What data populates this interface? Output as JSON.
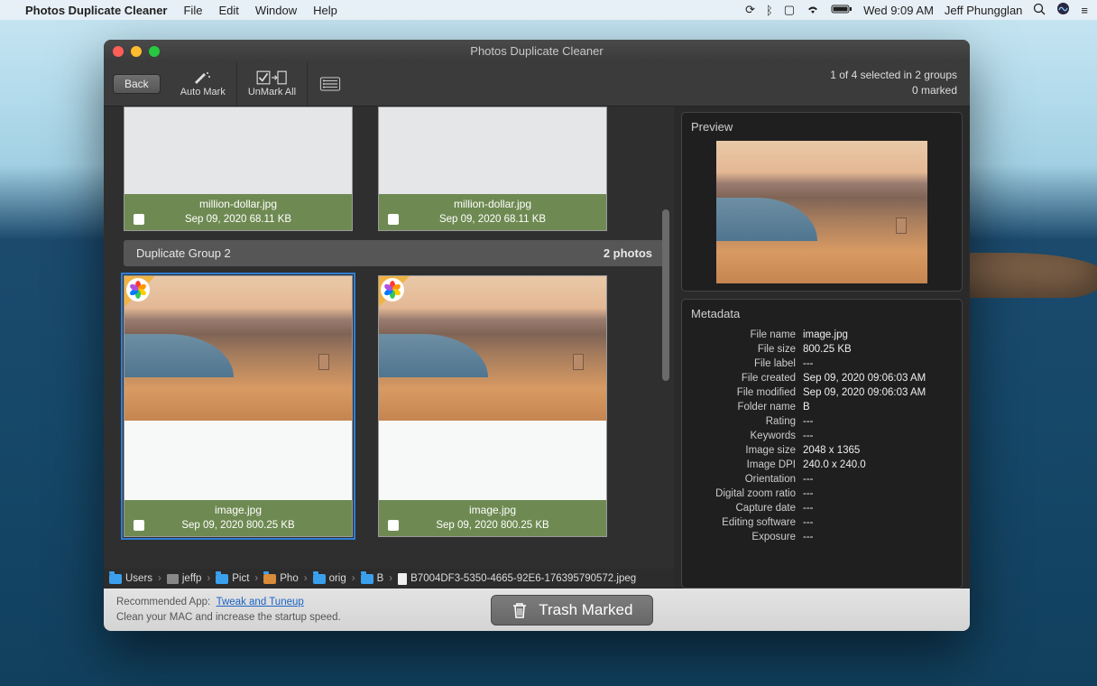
{
  "menubar": {
    "app_name": "Photos Duplicate Cleaner",
    "menus": [
      "File",
      "Edit",
      "Window",
      "Help"
    ],
    "clock": "Wed 9:09 AM",
    "user": "Jeff Phungglan"
  },
  "window": {
    "title": "Photos Duplicate Cleaner",
    "back": "Back",
    "tools": {
      "auto_mark": "Auto Mark",
      "unmark_all": "UnMark All"
    },
    "status_line1": "1 of 4 selected in 2 groups",
    "status_line2": "0 marked"
  },
  "groups": {
    "g1": {
      "cards": [
        {
          "name": "million-dollar.jpg",
          "sub": "Sep 09, 2020  68.11 KB"
        },
        {
          "name": "million-dollar.jpg",
          "sub": "Sep 09, 2020  68.11 KB"
        }
      ]
    },
    "g2": {
      "title": "Duplicate Group 2",
      "count": "2 photos",
      "cards": [
        {
          "name": "image.jpg",
          "sub": "Sep 09, 2020  800.25 KB"
        },
        {
          "name": "image.jpg",
          "sub": "Sep 09, 2020  800.25 KB"
        }
      ]
    }
  },
  "preview": {
    "title": "Preview"
  },
  "metadata": {
    "title": "Metadata",
    "rows": [
      {
        "k": "File name",
        "v": "image.jpg"
      },
      {
        "k": "File size",
        "v": "800.25 KB"
      },
      {
        "k": "File label",
        "v": "---"
      },
      {
        "k": "File created",
        "v": "Sep 09, 2020 09:06:03 AM"
      },
      {
        "k": "File modified",
        "v": "Sep 09, 2020 09:06:03 AM"
      },
      {
        "k": "Folder name",
        "v": "B"
      },
      {
        "k": "Rating",
        "v": "---"
      },
      {
        "k": "Keywords",
        "v": "---"
      },
      {
        "k": "Image size",
        "v": "2048 x 1365"
      },
      {
        "k": "Image DPI",
        "v": "240.0 x 240.0"
      },
      {
        "k": "Orientation",
        "v": "---"
      },
      {
        "k": "Digital zoom ratio",
        "v": "---"
      },
      {
        "k": "Capture date",
        "v": "---"
      },
      {
        "k": "Editing software",
        "v": "---"
      },
      {
        "k": "Exposure",
        "v": "---"
      }
    ]
  },
  "path": {
    "segs": [
      "Users",
      "jeffp",
      "Pict",
      "Pho",
      "orig",
      "B",
      "B7004DF3-5350-4665-92E6-176395790572.jpeg"
    ]
  },
  "footer": {
    "reco_label": "Recommended App:",
    "reco_link": "Tweak and Tuneup",
    "reco_sub": "Clean your MAC and increase the startup speed.",
    "trash": "Trash Marked"
  }
}
